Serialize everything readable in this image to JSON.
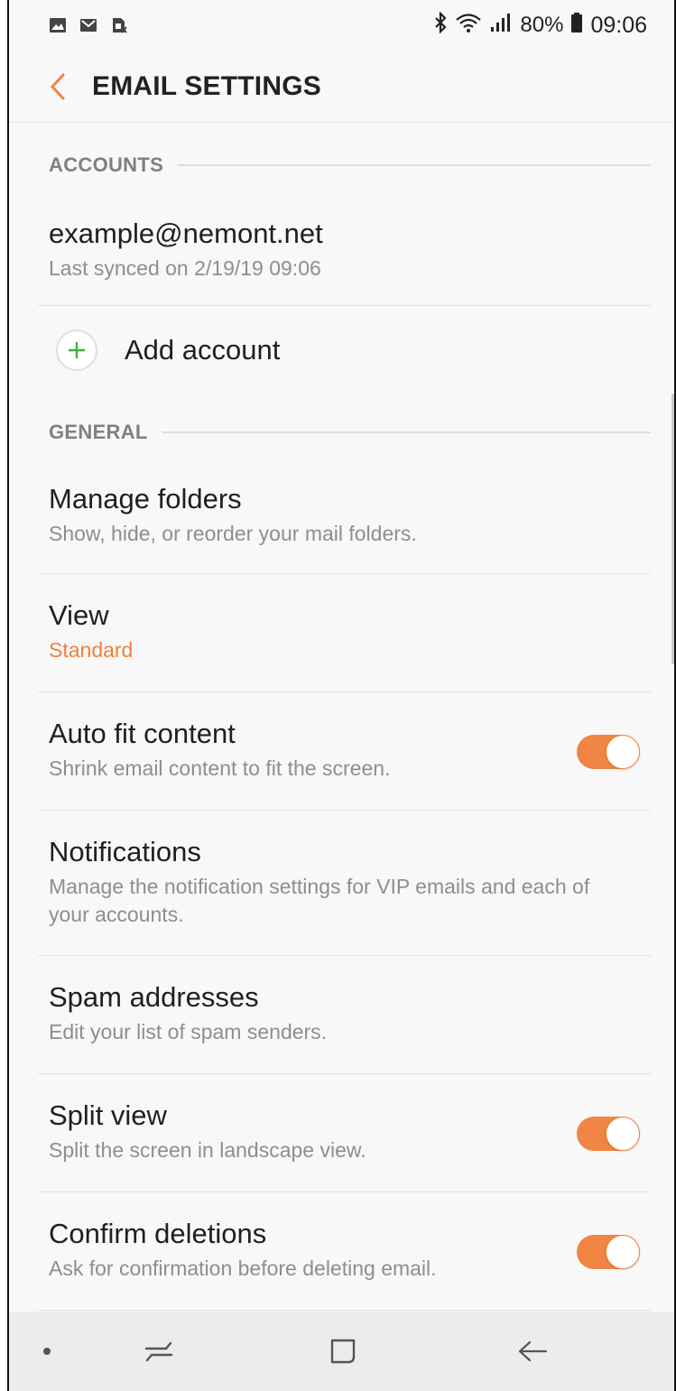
{
  "status_bar": {
    "battery": "80%",
    "time": "09:06",
    "icons": [
      "image-icon",
      "gmail-icon",
      "sim-icon",
      "bluetooth-icon",
      "wifi-icon",
      "signal-icon",
      "battery-icon"
    ]
  },
  "header": {
    "title": "EMAIL SETTINGS",
    "back_icon": "chevron-left-icon"
  },
  "accounts": {
    "section_label": "ACCOUNTS",
    "account_email": "example@nemont.net",
    "account_sync": "Last synced on 2/19/19  09:06",
    "add_account_label": "Add account"
  },
  "general": {
    "section_label": "GENERAL",
    "items": [
      {
        "title": "Manage folders",
        "subtitle": "Show, hide, or reorder your mail folders."
      },
      {
        "title": "View",
        "subtitle": "Standard"
      },
      {
        "title": "Auto fit content",
        "subtitle": "Shrink email content to fit the screen.",
        "toggle_on": true
      },
      {
        "title": "Notifications",
        "subtitle": "Manage the notification settings for VIP emails and each of your accounts."
      },
      {
        "title": "Spam addresses",
        "subtitle": "Edit your list of spam senders."
      },
      {
        "title": "Split view",
        "subtitle": "Split the screen in landscape view.",
        "toggle_on": true
      },
      {
        "title": "Confirm deletions",
        "subtitle": "Ask for confirmation before deleting email.",
        "toggle_on": true
      }
    ]
  },
  "colors": {
    "accent": "#f08544",
    "background": "#f8f8f8",
    "add_icon": "#3cb043"
  },
  "nav_bar": {
    "buttons": [
      "recents-icon",
      "home-icon",
      "back-icon"
    ]
  }
}
